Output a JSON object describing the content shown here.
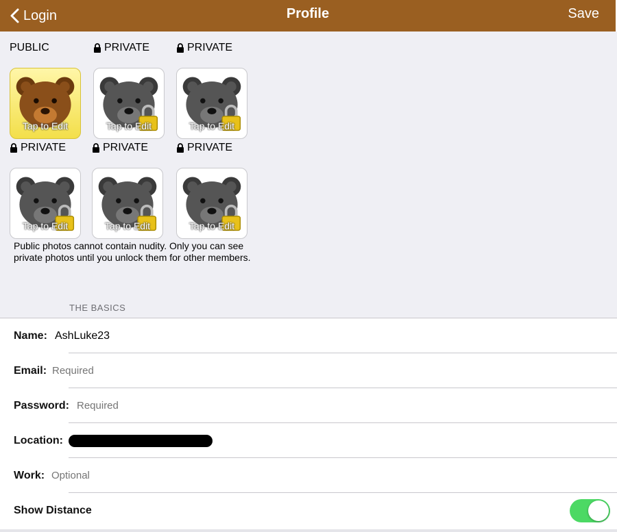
{
  "navbar": {
    "back_label": "Login",
    "title": "Profile",
    "save_label": "Save",
    "color": "#9a5f21"
  },
  "photos": {
    "slots": [
      {
        "label": "PUBLIC",
        "locked": false,
        "tap_text": "Tap to Edit"
      },
      {
        "label": "PRIVATE",
        "locked": true,
        "tap_text": "Tap to Edit"
      },
      {
        "label": "PRIVATE",
        "locked": true,
        "tap_text": "Tap to Edit"
      },
      {
        "label": "PRIVATE",
        "locked": true,
        "tap_text": "Tap to Edit"
      },
      {
        "label": "PRIVATE",
        "locked": true,
        "tap_text": "Tap to Edit"
      },
      {
        "label": "PRIVATE",
        "locked": true,
        "tap_text": "Tap to Edit"
      }
    ],
    "note": "Public photos cannot contain nudity.  Only you can see private photos until you unlock them for other members."
  },
  "basics": {
    "header": "THE BASICS",
    "name_label": "Name:",
    "name_value": "AshLuke23",
    "email_label": "Email:",
    "email_placeholder": "Required",
    "password_label": "Password:",
    "password_placeholder": "Required",
    "location_label": "Location:",
    "work_label": "Work:",
    "work_placeholder": "Optional",
    "distance_label": "Show Distance",
    "distance_on": true,
    "toggle_color": "#4cd964"
  }
}
